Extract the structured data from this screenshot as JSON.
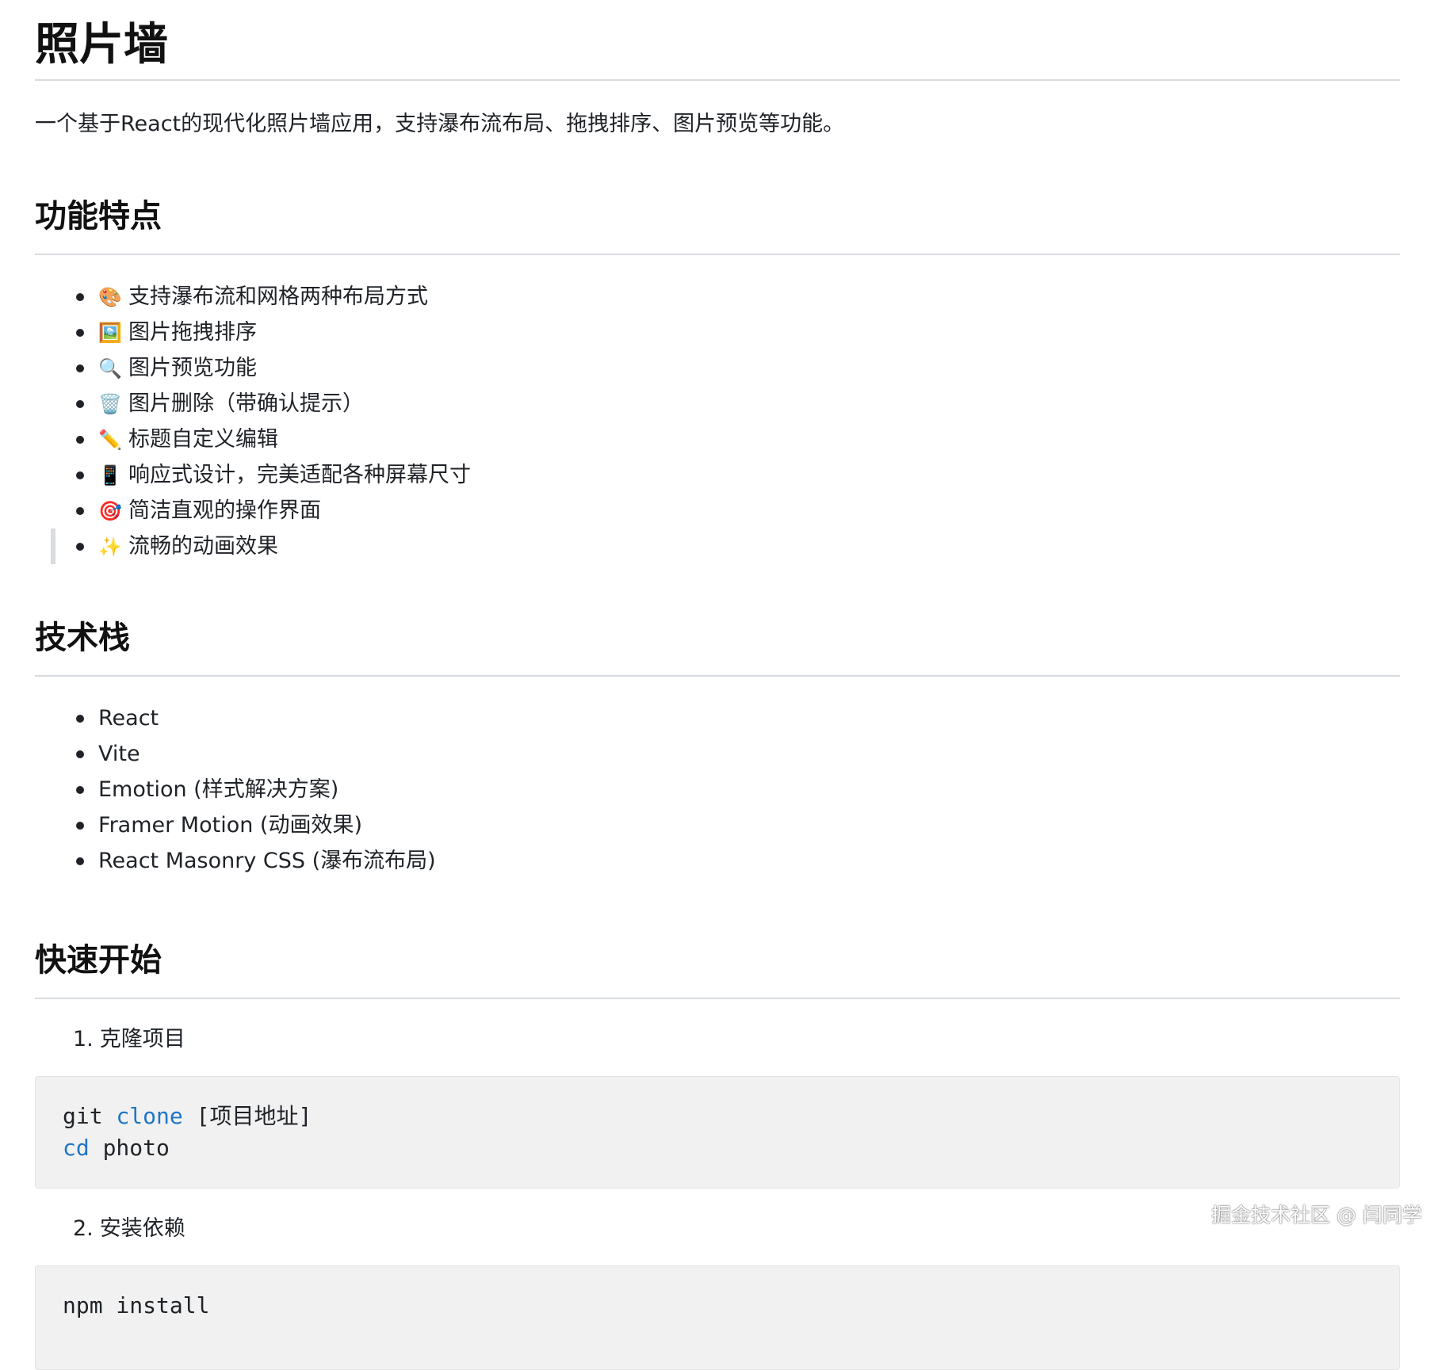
{
  "title": "照片墙",
  "intro": "一个基于React的现代化照片墙应用，支持瀑布流布局、拖拽排序、图片预览等功能。",
  "features": {
    "heading": "功能特点",
    "items": [
      {
        "emoji": "🎨",
        "icon": "palette-icon",
        "text": "支持瀑布流和网格两种布局方式"
      },
      {
        "emoji": "🖼️",
        "icon": "framed-picture-icon",
        "text": "图片拖拽排序"
      },
      {
        "emoji": "🔍",
        "icon": "magnifier-icon",
        "text": "图片预览功能"
      },
      {
        "emoji": "🗑️",
        "icon": "trash-icon",
        "text": "图片删除（带确认提示）"
      },
      {
        "emoji": "✏️",
        "icon": "pencil-icon",
        "text": "标题自定义编辑"
      },
      {
        "emoji": "📱",
        "icon": "mobile-phone-icon",
        "text": "响应式设计，完美适配各种屏幕尺寸"
      },
      {
        "emoji": "🎯",
        "icon": "target-icon",
        "text": "简洁直观的操作界面"
      },
      {
        "emoji": "✨",
        "icon": "sparkles-icon",
        "text": "流畅的动画效果"
      }
    ]
  },
  "tech": {
    "heading": "技术栈",
    "items": [
      "React",
      "Vite",
      "Emotion (样式解决方案)",
      "Framer Motion (动画效果)",
      "React Masonry CSS (瀑布流布局)"
    ]
  },
  "quickstart": {
    "heading": "快速开始",
    "steps": [
      {
        "num": "1.",
        "label": "克隆项目",
        "code": [
          {
            "cmd": "git",
            "kw": "clone",
            "rest": "[项目地址]"
          },
          {
            "cmd": "",
            "kw": "cd",
            "rest": "photo"
          }
        ]
      },
      {
        "num": "2.",
        "label": "安装依赖",
        "code": [
          {
            "cmd": "npm install",
            "kw": "",
            "rest": ""
          }
        ]
      }
    ]
  },
  "watermark": "掘金技术社区 @ 闫同学",
  "colors": {
    "keyword": "#1f75c7",
    "code_bg": "#f1f1f1",
    "rule": "#d7dbe0"
  }
}
